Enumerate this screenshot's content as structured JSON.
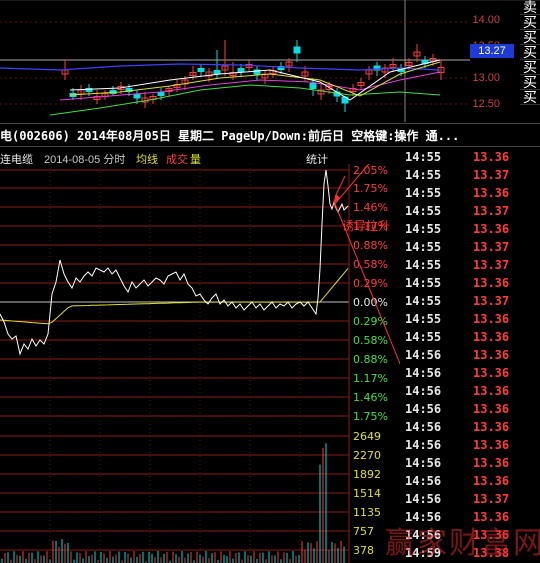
{
  "kline_panel": {
    "price_axis": [
      "14.00",
      "13.50",
      "13.00",
      "12.50"
    ],
    "current_price": "13.27",
    "trade_buttons": [
      "卖",
      "买",
      "买",
      "买",
      "买",
      "买",
      "买"
    ],
    "colors": {
      "up": "#ff3c3c",
      "down": "#00e0e0",
      "ma5": "#ffffff",
      "ma10": "#e0e020",
      "ma20": "#e040e0",
      "ma60": "#40e040"
    }
  },
  "titlebar": {
    "text": "电(002606) 2014年08月05日 星期二 PageUp/Down:前后日 空格键:操作 通..."
  },
  "info_line": {
    "stock_name": "连电缆",
    "date": "2014-08-05 分时",
    "avg_label": "均线",
    "vol_label_a": "成交",
    "vol_label_b": "量",
    "stats_label": "统计"
  },
  "price_axis_labels": {
    "upper": [
      "2.05%",
      "1.75%",
      "1.46%",
      "1.17%",
      "0.88%",
      "0.58%",
      "0.29%"
    ],
    "zero": "0.00%",
    "lower": [
      "0.29%",
      "0.58%",
      "0.88%",
      "1.17%",
      "1.46%",
      "1.75%"
    ]
  },
  "volume_axis_labels": [
    "2649",
    "2270",
    "1892",
    "1514",
    "1135",
    "757",
    "378"
  ],
  "annotation": "诱导拉升",
  "trade_list": [
    {
      "time": "14:55",
      "price": "13.36"
    },
    {
      "time": "14:55",
      "price": "13.37"
    },
    {
      "time": "14:55",
      "price": "13.36"
    },
    {
      "time": "14:55",
      "price": "13.37"
    },
    {
      "time": "14:55",
      "price": "13.36"
    },
    {
      "time": "14:55",
      "price": "13.37"
    },
    {
      "time": "14:55",
      "price": "13.37"
    },
    {
      "time": "14:55",
      "price": "13.36"
    },
    {
      "time": "14:55",
      "price": "13.37"
    },
    {
      "time": "14:55",
      "price": "13.36"
    },
    {
      "time": "14:55",
      "price": "13.36"
    },
    {
      "time": "14:56",
      "price": "13.36"
    },
    {
      "time": "14:56",
      "price": "13.36"
    },
    {
      "time": "14:56",
      "price": "13.36"
    },
    {
      "time": "14:56",
      "price": "13.36"
    },
    {
      "time": "14:56",
      "price": "13.36"
    },
    {
      "time": "14:56",
      "price": "13.36"
    },
    {
      "time": "14:56",
      "price": "13.36"
    },
    {
      "time": "14:56",
      "price": "13.36"
    },
    {
      "time": "14:56",
      "price": "13.37"
    },
    {
      "time": "14:56",
      "price": "13.36"
    },
    {
      "time": "14:56",
      "price": "13.36"
    },
    {
      "time": "14:59",
      "price": "13.38"
    }
  ],
  "watermark": "赢家财富网"
}
